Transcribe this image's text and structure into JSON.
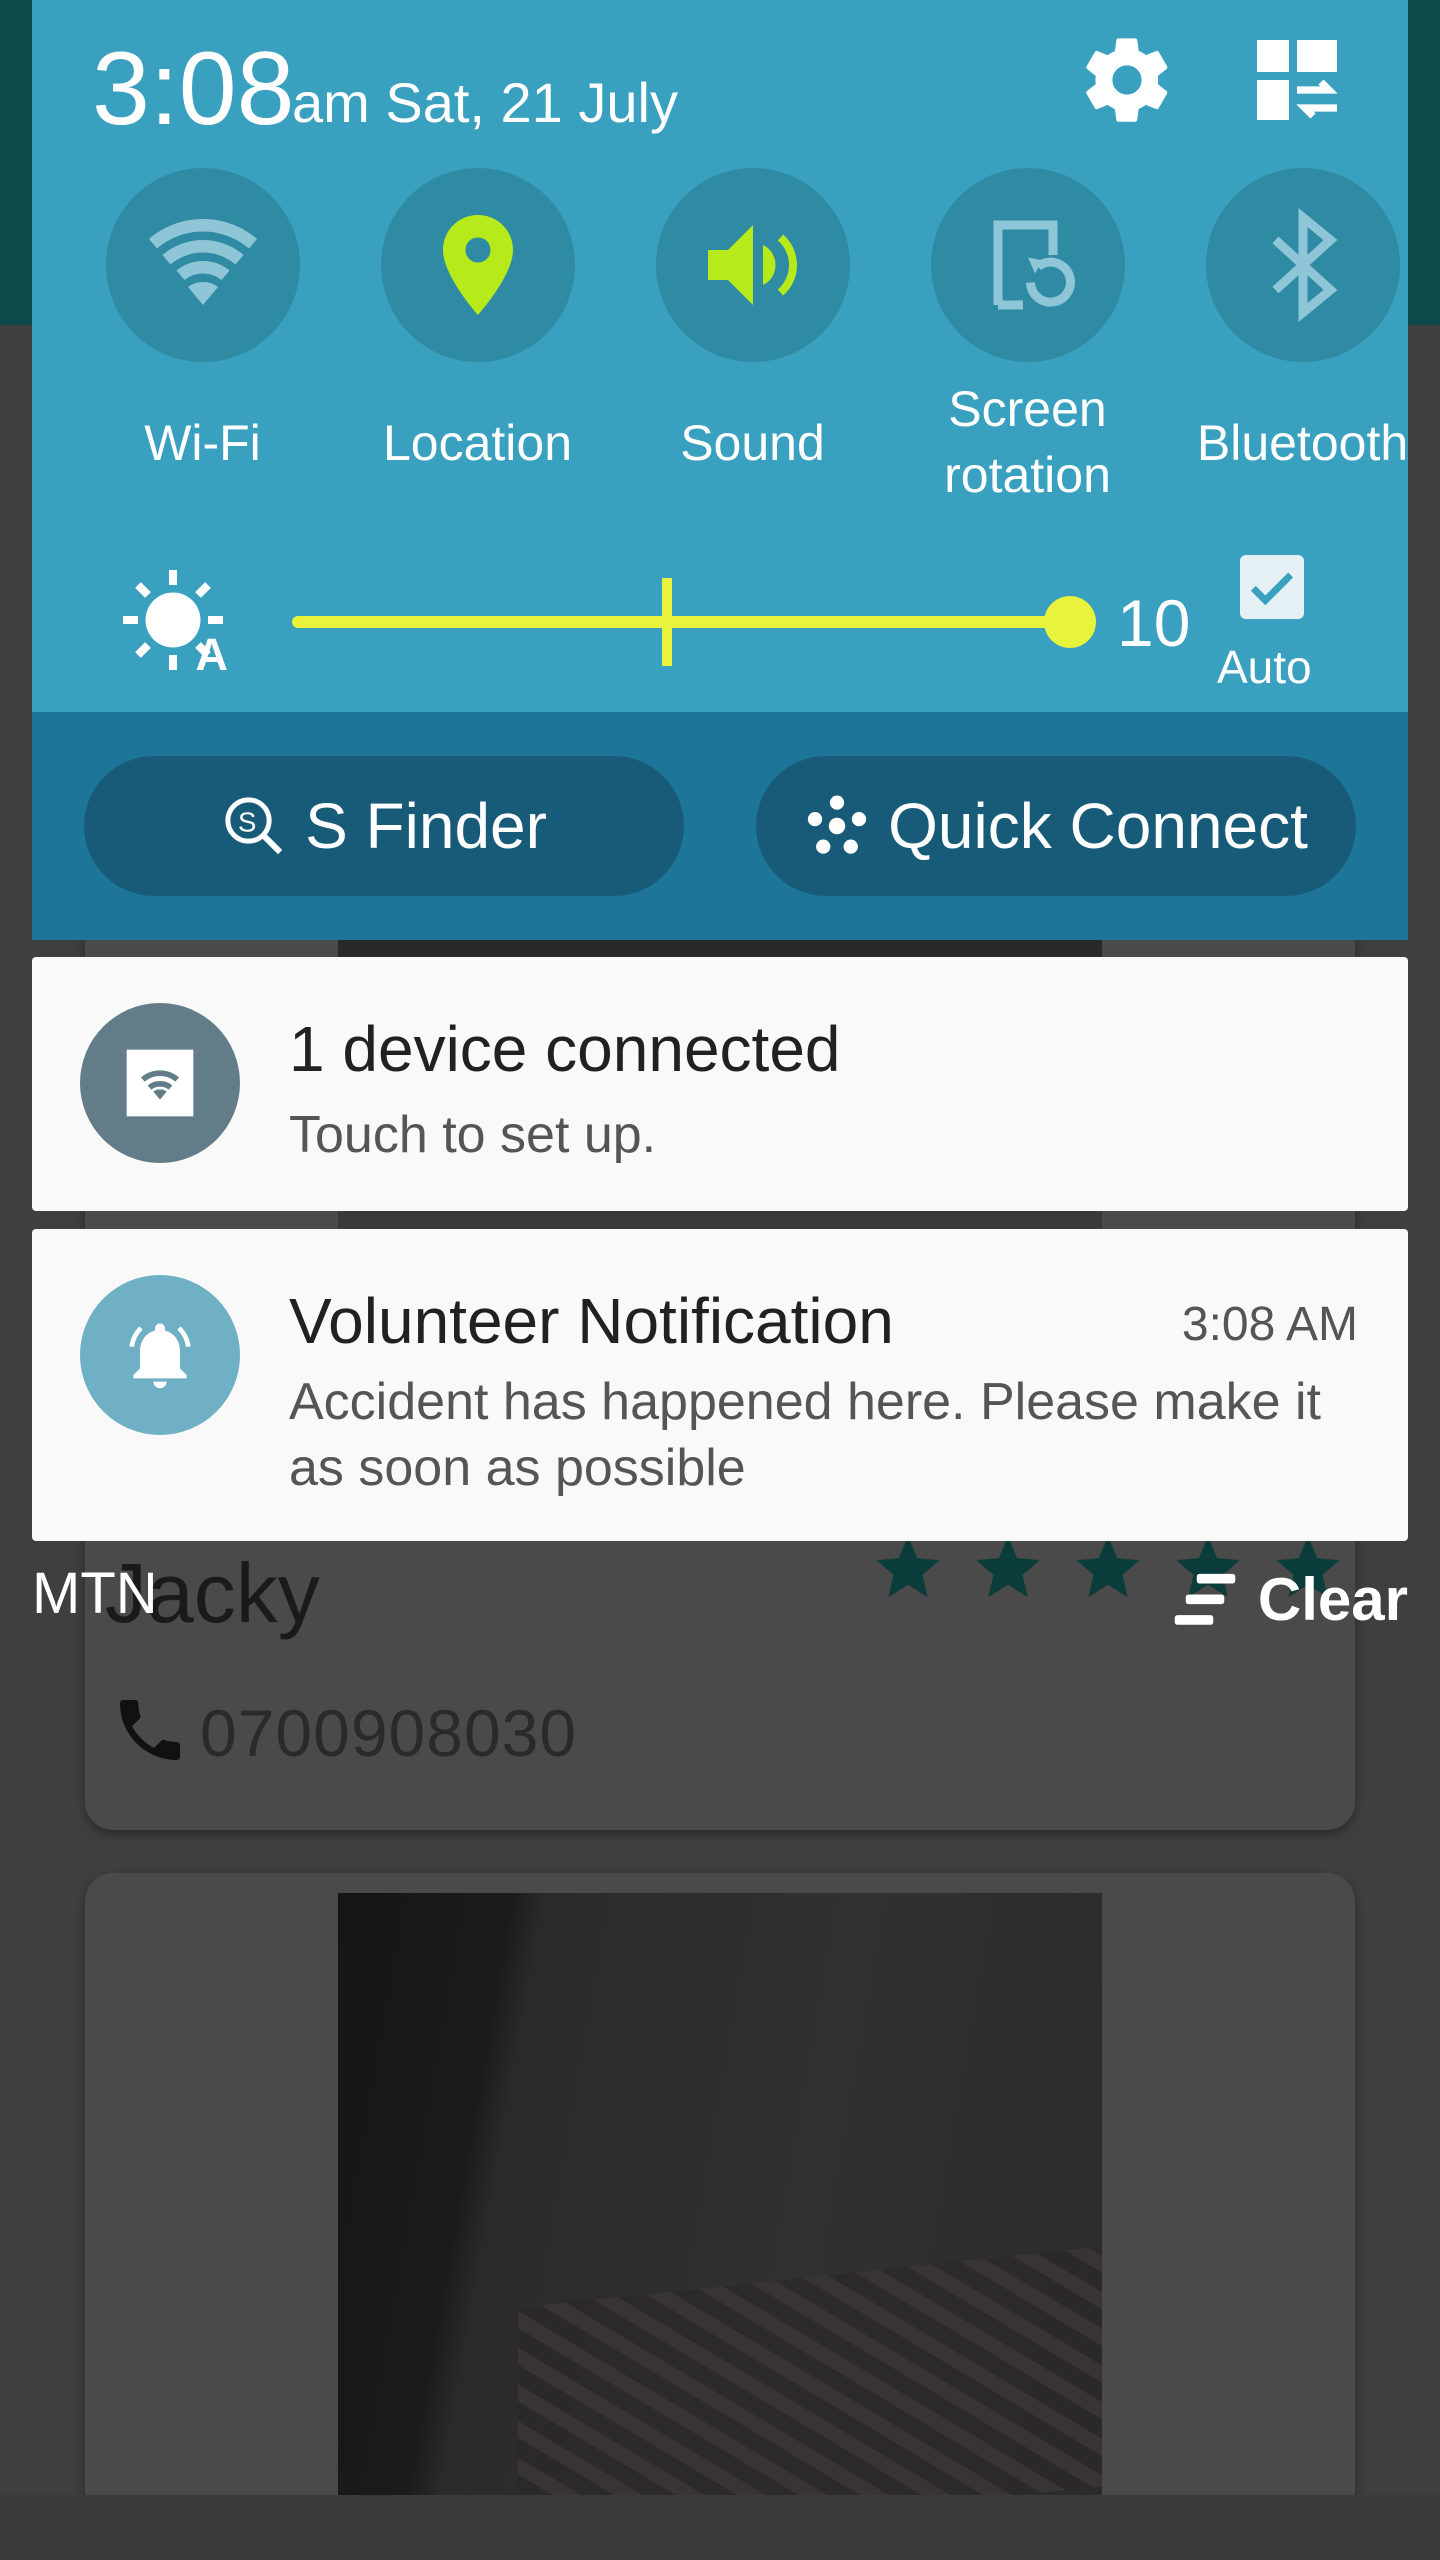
{
  "status": {
    "time": "3:08",
    "date": "am Sat, 21 July"
  },
  "header_icons": {
    "settings": "gear-icon",
    "edit": "edit-quick-settings-icon"
  },
  "toggles": [
    {
      "label": "Wi-Fi",
      "icon": "wifi-icon",
      "active": false
    },
    {
      "label": "Location",
      "icon": "location-pin-icon",
      "active": true
    },
    {
      "label": "Sound",
      "icon": "speaker-icon",
      "active": true
    },
    {
      "label": "Screen rotation",
      "icon": "screen-rotation-icon",
      "active": false
    },
    {
      "label": "Bluetooth",
      "icon": "bluetooth-icon",
      "active": false
    }
  ],
  "brightness": {
    "value": "10",
    "level": 1.0,
    "auto_label": "Auto",
    "auto_checked": true
  },
  "actions": {
    "s_finder": "S Finder",
    "quick_connect": "Quick Connect"
  },
  "notifications": [
    {
      "title": "1 device connected",
      "body": "Touch to set up.",
      "icon": "wifi-hotspot-icon"
    },
    {
      "title": "Volunteer Notification",
      "time": "3:08 AM",
      "body": "Accident has happened here. Please make it as soon as possible",
      "icon": "bell-icon"
    }
  ],
  "footer": {
    "carrier": "MTN",
    "clear": "Clear"
  },
  "background_app": {
    "name": "Jacky",
    "phone": "0700908030",
    "rating_stars": 5
  },
  "colors": {
    "shade": "#3aa0bf",
    "shade_lower": "#1d7699",
    "accent": "#e8f33b",
    "active_icon": "#b6ea1b"
  }
}
